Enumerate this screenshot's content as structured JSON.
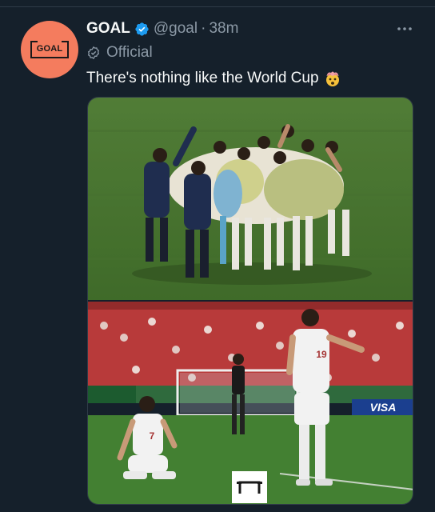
{
  "tweet": {
    "display_name": "GOAL",
    "handle": "@goal",
    "separator": "·",
    "time": "38m",
    "label": "Official",
    "text": "There's nothing like the World Cup",
    "emoji": "exploding-head-emoji",
    "avatar_text": "GOAL"
  },
  "media": {
    "photo_1": {
      "description_icon": "team-celebration-photo"
    },
    "photo_2": {
      "description_icon": "players-kneeling-celebration-photo",
      "ad_board_text": "VISA",
      "jersey_left": "7",
      "jersey_right": "19"
    }
  },
  "colors": {
    "background": "#15202b",
    "verified": "#1d9bf0",
    "secondary_text": "#8b98a5",
    "avatar_bg": "#f47c5e"
  }
}
